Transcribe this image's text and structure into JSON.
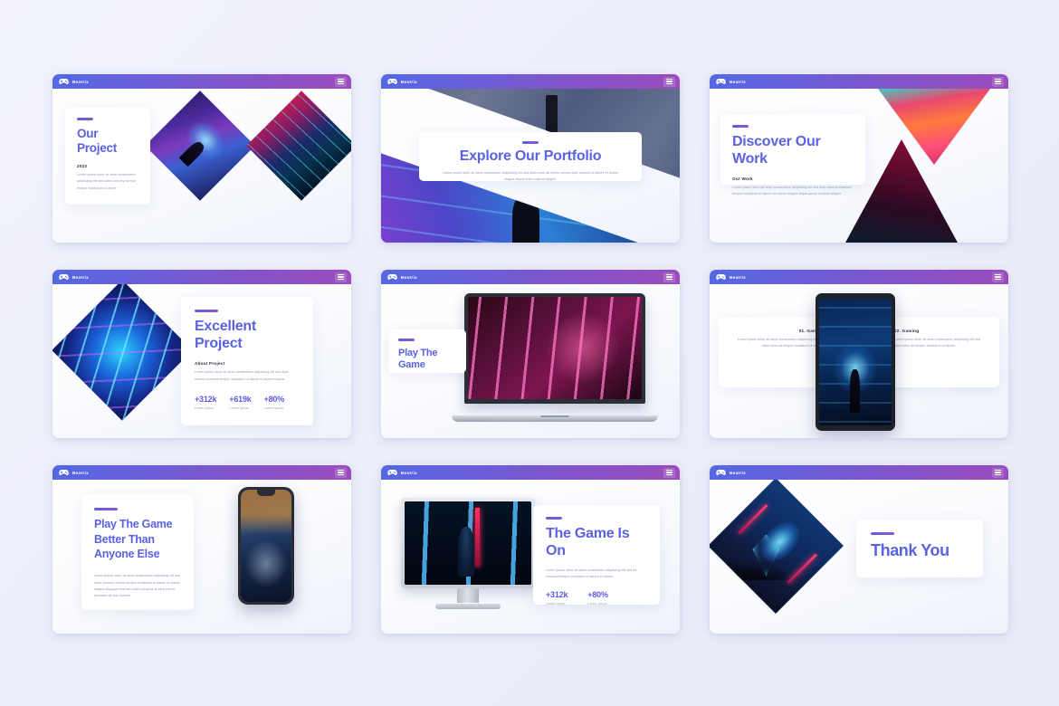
{
  "brand": {
    "name": "Beatrix",
    "icon": "gamepad-icon",
    "menu_icon": "hamburger-menu-icon"
  },
  "theme": {
    "background": "#eceefa",
    "header_gradient_start": "#5468e3",
    "header_gradient_end": "#9a4cbc",
    "accent_text": "#5a62e2",
    "muted_text": "#9298b4"
  },
  "lorem": {
    "short": "Lorem ipsum dolor sit amet consectetur adipiscing elit sed diam eiusmod tempor incididunt ut labore et dolore magna aliqua enim ad minim.",
    "medium": "Lorem ipsum dolor sit amet consectetur adipiscing elit sed diam nonumy eirmod tempor invidunt ut labore et dolore magna aliquyam erat sed diam.",
    "long": "Lorem ipsum dolor sit amet consectetur adipiscing elit sed do eiusmod tempor incididunt ut labore et dolore magna aliqua enim ad minim veniam quis nostrud exercitation ullamco laboris nisi ut aliquip.",
    "body": "Lorem ipsum dolor sit amet consectetur adipiscing elit sed diam nonumy eirmod tempor invidunt ut labore et dolore magna aliquyam erat sed diam voluptua at vero eos et accusam."
  },
  "slides": [
    {
      "n": 1,
      "title": "Our Project",
      "subtitle": "2023",
      "body": "Lorem ipsum dolor sit amet consectetur adipiscing elit sed diam nonumy eirmod tempor incididunt ut labore.",
      "art": [
        "diamond-neon-crowd",
        "diamond-rain"
      ]
    },
    {
      "n": 2,
      "title": "Explore Our Portfolio",
      "body": "Lorem ipsum dolor sit amet consectetur adipiscing elit sed diam enim ad minim veniam quis nostrud ut labore et dolore magna aliqua enim nostrud aliquet.",
      "art": [
        "city-street-photo"
      ]
    },
    {
      "n": 3,
      "title": "Discover Our Work",
      "subtitle": "Our Work",
      "body": "Lorem ipsum dolor sit amet consectetur adipiscing elit sed diam eirmod eiusmod tempor incididunt ut labore sit dolore magna aliqua ipsum invidunt aliquet.",
      "art": [
        "triangle-down-sunset",
        "triangle-up-crimson"
      ]
    },
    {
      "n": 4,
      "title": "Excellent Project",
      "subtitle": "About Project",
      "body": "Lorem ipsum dolor sit amet consectetur adipiscing elit sed diam eirmod eiusmod tempor incididunt ut labore et dolore magna.",
      "stats": [
        {
          "value": "+312k",
          "label": "Lorem Ipsum"
        },
        {
          "value": "+619k",
          "label": "Lorem Ipsum"
        },
        {
          "value": "+80%",
          "label": "Lorem Ipsum"
        }
      ],
      "art": [
        "diamond-blue-lines"
      ]
    },
    {
      "n": 5,
      "title": "Play The Game",
      "art": [
        "laptop-neon-girl"
      ]
    },
    {
      "n": 6,
      "columns": [
        {
          "heading": "01. Gaming",
          "body": "Lorem ipsum dolor sit amet consectetur adipiscing elit sed diam enim ad tempor incididunt ut labore."
        },
        {
          "heading": "02. Gaming",
          "body": "Lorem ipsum dolor sit amet consectetur adipiscing elit sed diam enim ad tempor incididunt ut labore."
        }
      ],
      "art": [
        "tablet-cyber-alley"
      ]
    },
    {
      "n": 7,
      "title": "Play The Game Better Than Anyone Else",
      "body": "Lorem ipsum dolor sit amet consectetur adipiscing elit sed diam nonumy eirmod tempor incididunt ut labore et dolore magna aliquyam erat sed diam voluptua at vero eos et accusam sit duo dolores.",
      "art": [
        "phone-rapper"
      ]
    },
    {
      "n": 8,
      "title": "The Game Is On",
      "body": "Lorem ipsum dolor sit amet consectetur adipiscing elit sed do eiusmod tempor incididunt ut labore et dolore.",
      "stats": [
        {
          "value": "+312k",
          "label": "Lorem Ipsum"
        },
        {
          "value": "+80%",
          "label": "Lorem Ipsum"
        }
      ],
      "art": [
        "monitor-blue-bars"
      ]
    },
    {
      "n": 9,
      "title": "Thank You",
      "art": [
        "diamond-club-gem"
      ]
    }
  ]
}
